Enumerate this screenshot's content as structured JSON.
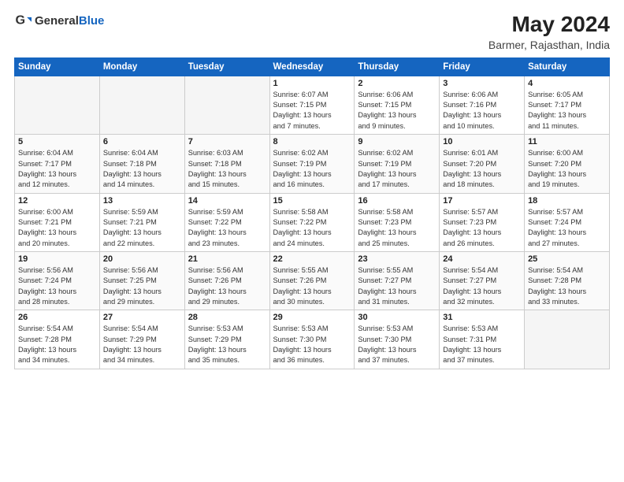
{
  "logo": {
    "general": "General",
    "blue": "Blue"
  },
  "title": "May 2024",
  "subtitle": "Barmer, Rajasthan, India",
  "weekdays": [
    "Sunday",
    "Monday",
    "Tuesday",
    "Wednesday",
    "Thursday",
    "Friday",
    "Saturday"
  ],
  "weeks": [
    [
      {
        "day": "",
        "detail": ""
      },
      {
        "day": "",
        "detail": ""
      },
      {
        "day": "",
        "detail": ""
      },
      {
        "day": "1",
        "detail": "Sunrise: 6:07 AM\nSunset: 7:15 PM\nDaylight: 13 hours\nand 7 minutes."
      },
      {
        "day": "2",
        "detail": "Sunrise: 6:06 AM\nSunset: 7:15 PM\nDaylight: 13 hours\nand 9 minutes."
      },
      {
        "day": "3",
        "detail": "Sunrise: 6:06 AM\nSunset: 7:16 PM\nDaylight: 13 hours\nand 10 minutes."
      },
      {
        "day": "4",
        "detail": "Sunrise: 6:05 AM\nSunset: 7:17 PM\nDaylight: 13 hours\nand 11 minutes."
      }
    ],
    [
      {
        "day": "5",
        "detail": "Sunrise: 6:04 AM\nSunset: 7:17 PM\nDaylight: 13 hours\nand 12 minutes."
      },
      {
        "day": "6",
        "detail": "Sunrise: 6:04 AM\nSunset: 7:18 PM\nDaylight: 13 hours\nand 14 minutes."
      },
      {
        "day": "7",
        "detail": "Sunrise: 6:03 AM\nSunset: 7:18 PM\nDaylight: 13 hours\nand 15 minutes."
      },
      {
        "day": "8",
        "detail": "Sunrise: 6:02 AM\nSunset: 7:19 PM\nDaylight: 13 hours\nand 16 minutes."
      },
      {
        "day": "9",
        "detail": "Sunrise: 6:02 AM\nSunset: 7:19 PM\nDaylight: 13 hours\nand 17 minutes."
      },
      {
        "day": "10",
        "detail": "Sunrise: 6:01 AM\nSunset: 7:20 PM\nDaylight: 13 hours\nand 18 minutes."
      },
      {
        "day": "11",
        "detail": "Sunrise: 6:00 AM\nSunset: 7:20 PM\nDaylight: 13 hours\nand 19 minutes."
      }
    ],
    [
      {
        "day": "12",
        "detail": "Sunrise: 6:00 AM\nSunset: 7:21 PM\nDaylight: 13 hours\nand 20 minutes."
      },
      {
        "day": "13",
        "detail": "Sunrise: 5:59 AM\nSunset: 7:21 PM\nDaylight: 13 hours\nand 22 minutes."
      },
      {
        "day": "14",
        "detail": "Sunrise: 5:59 AM\nSunset: 7:22 PM\nDaylight: 13 hours\nand 23 minutes."
      },
      {
        "day": "15",
        "detail": "Sunrise: 5:58 AM\nSunset: 7:22 PM\nDaylight: 13 hours\nand 24 minutes."
      },
      {
        "day": "16",
        "detail": "Sunrise: 5:58 AM\nSunset: 7:23 PM\nDaylight: 13 hours\nand 25 minutes."
      },
      {
        "day": "17",
        "detail": "Sunrise: 5:57 AM\nSunset: 7:23 PM\nDaylight: 13 hours\nand 26 minutes."
      },
      {
        "day": "18",
        "detail": "Sunrise: 5:57 AM\nSunset: 7:24 PM\nDaylight: 13 hours\nand 27 minutes."
      }
    ],
    [
      {
        "day": "19",
        "detail": "Sunrise: 5:56 AM\nSunset: 7:24 PM\nDaylight: 13 hours\nand 28 minutes."
      },
      {
        "day": "20",
        "detail": "Sunrise: 5:56 AM\nSunset: 7:25 PM\nDaylight: 13 hours\nand 29 minutes."
      },
      {
        "day": "21",
        "detail": "Sunrise: 5:56 AM\nSunset: 7:26 PM\nDaylight: 13 hours\nand 29 minutes."
      },
      {
        "day": "22",
        "detail": "Sunrise: 5:55 AM\nSunset: 7:26 PM\nDaylight: 13 hours\nand 30 minutes."
      },
      {
        "day": "23",
        "detail": "Sunrise: 5:55 AM\nSunset: 7:27 PM\nDaylight: 13 hours\nand 31 minutes."
      },
      {
        "day": "24",
        "detail": "Sunrise: 5:54 AM\nSunset: 7:27 PM\nDaylight: 13 hours\nand 32 minutes."
      },
      {
        "day": "25",
        "detail": "Sunrise: 5:54 AM\nSunset: 7:28 PM\nDaylight: 13 hours\nand 33 minutes."
      }
    ],
    [
      {
        "day": "26",
        "detail": "Sunrise: 5:54 AM\nSunset: 7:28 PM\nDaylight: 13 hours\nand 34 minutes."
      },
      {
        "day": "27",
        "detail": "Sunrise: 5:54 AM\nSunset: 7:29 PM\nDaylight: 13 hours\nand 34 minutes."
      },
      {
        "day": "28",
        "detail": "Sunrise: 5:53 AM\nSunset: 7:29 PM\nDaylight: 13 hours\nand 35 minutes."
      },
      {
        "day": "29",
        "detail": "Sunrise: 5:53 AM\nSunset: 7:30 PM\nDaylight: 13 hours\nand 36 minutes."
      },
      {
        "day": "30",
        "detail": "Sunrise: 5:53 AM\nSunset: 7:30 PM\nDaylight: 13 hours\nand 37 minutes."
      },
      {
        "day": "31",
        "detail": "Sunrise: 5:53 AM\nSunset: 7:31 PM\nDaylight: 13 hours\nand 37 minutes."
      },
      {
        "day": "",
        "detail": ""
      }
    ]
  ]
}
